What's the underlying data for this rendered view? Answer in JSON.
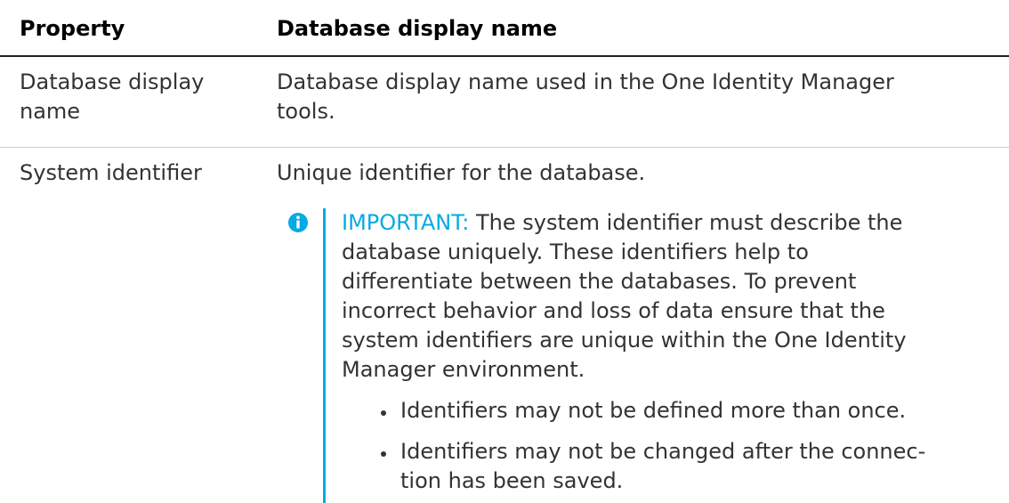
{
  "table": {
    "headers": [
      "Property",
      "Database display name"
    ],
    "rows": [
      {
        "property_lines": [
          "Database display",
          "name"
        ],
        "description_lines": [
          "Database display name used in the One Identity Manager",
          "tools."
        ]
      },
      {
        "property_lines": [
          "System identifier"
        ],
        "description_lines": [
          "Unique identifier for the database."
        ],
        "note": {
          "icon": "info-icon",
          "accent_color": "#04aae3",
          "label": "IMPORTANT:",
          "first_line_rest": " The system identifier must describe the",
          "lines": [
            "database uniquely. These identifiers help to",
            "differentiate between the databases. To prevent",
            "incorrect behavior and loss of data ensure that the",
            "system identifiers are unique within the One Identity",
            "Manager environment."
          ],
          "bullets": [
            {
              "lines": [
                "Identifiers may not be defined more than once."
              ]
            },
            {
              "lines": [
                "Identifiers may not be changed after the connec-",
                "tion has been saved."
              ]
            }
          ]
        }
      }
    ]
  }
}
